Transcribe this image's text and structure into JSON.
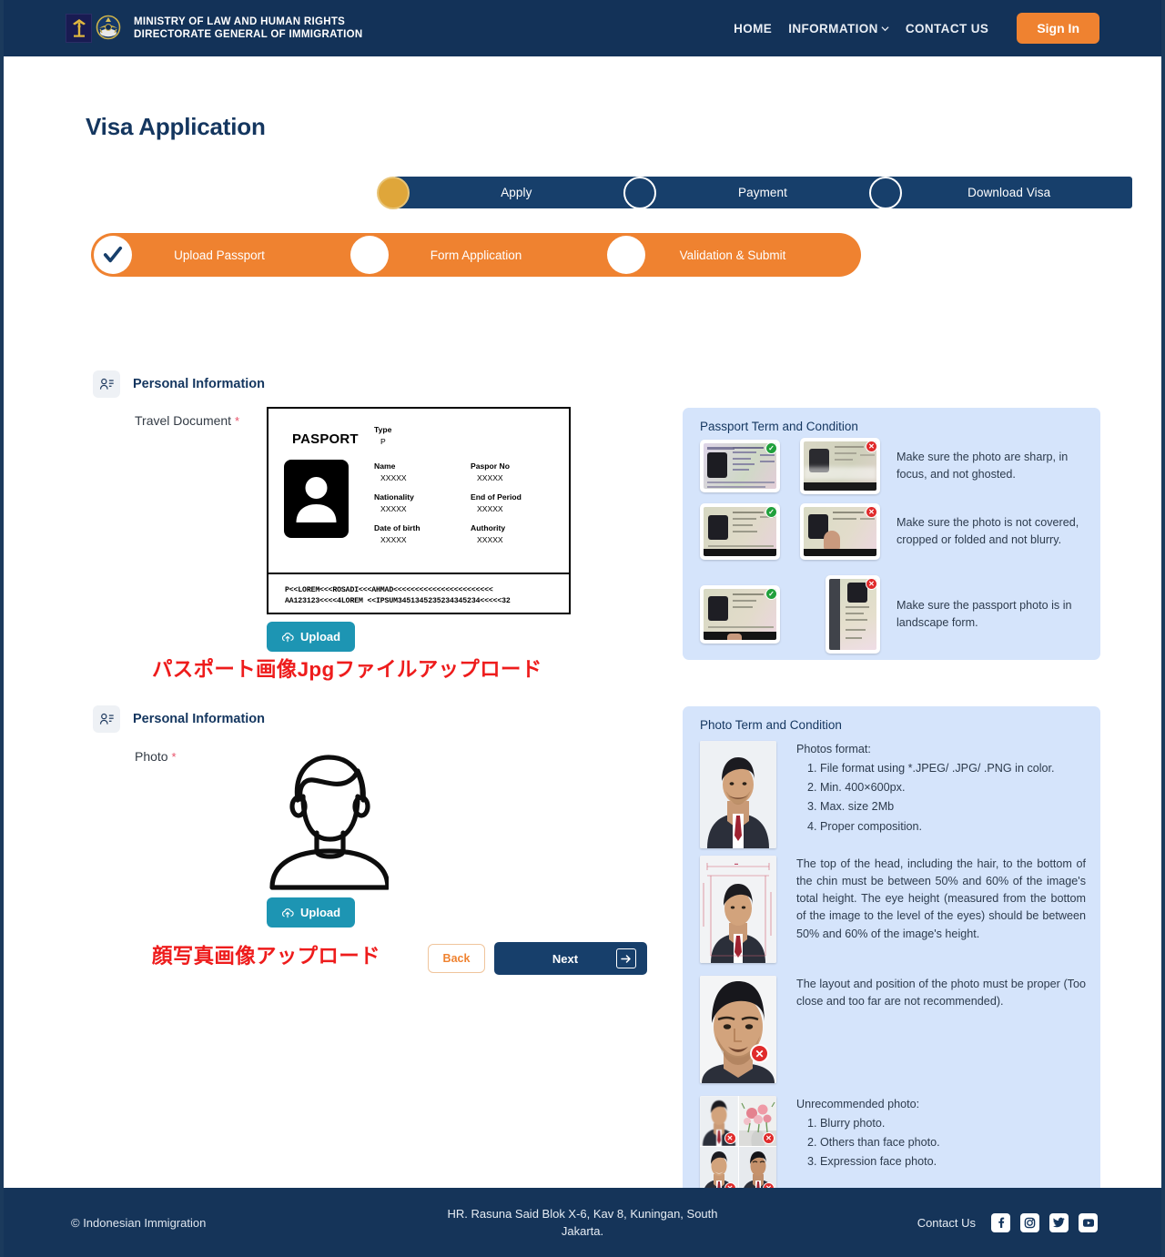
{
  "header": {
    "brand_line1": "MINISTRY OF  LAW  AND HUMAN RIGHTS",
    "brand_line2": "DIRECTORATE GENERAL OF IMMIGRATION",
    "nav": [
      {
        "label": "HOME",
        "has_caret": false
      },
      {
        "label": "INFORMATION",
        "has_caret": true
      },
      {
        "label": "CONTACT US",
        "has_caret": false
      }
    ],
    "sign_in": "Sign In"
  },
  "page": {
    "title": "Visa Application"
  },
  "top_steps": [
    {
      "label": "Apply",
      "state": "active"
    },
    {
      "label": "Payment",
      "state": "pending"
    },
    {
      "label": "Download Visa",
      "state": "pending"
    }
  ],
  "sub_steps": [
    {
      "label": "Upload Passport",
      "state": "done"
    },
    {
      "label": "Form Application",
      "state": "pending"
    },
    {
      "label": "Validation & Submit",
      "state": "pending"
    }
  ],
  "sections": {
    "travel_document": {
      "section_title": "Personal Information",
      "field_label": "Travel Document",
      "required_mark": "*",
      "upload_label": "Upload",
      "annotation": "パスポート画像Jpgファイルアップロード"
    },
    "photo": {
      "section_title": "Personal Information",
      "field_label": "Photo",
      "required_mark": "*",
      "upload_label": "Upload",
      "annotation": "顔写真画像アップロード"
    }
  },
  "passport_preview": {
    "word": "PASPORT",
    "type_key": "Type",
    "type_value": "P",
    "fields": [
      {
        "key": "Name",
        "value": "XXXXX"
      },
      {
        "key": "Paspor No",
        "value": "XXXXX"
      },
      {
        "key": "Nationality",
        "value": "XXXXX"
      },
      {
        "key": "End of Period",
        "value": "XXXXX"
      },
      {
        "key": "Date of birth",
        "value": "XXXXX"
      },
      {
        "key": "Authority",
        "value": "XXXXX"
      }
    ],
    "mrz_line1": "P<<LOREM<<<ROSADI<<<AHMAD<<<<<<<<<<<<<<<<<<<<<<<",
    "mrz_line2": "AA123123<<<<4LOREM <<IPSUM3451345235234345234<<<<<32"
  },
  "buttons": {
    "back": "Back",
    "next": "Next"
  },
  "passport_terms": {
    "title": "Passport Term and Condition",
    "rows": [
      {
        "text": "Make sure the photo are sharp, in focus, and not ghosted.",
        "badges": [
          "ok",
          "no"
        ]
      },
      {
        "text": "Make sure the photo is not covered, cropped or folded and not blurry.",
        "badges": [
          "ok",
          "no"
        ]
      },
      {
        "text": "Make sure the passport photo is in landscape form.",
        "badges": [
          "ok",
          "no"
        ]
      }
    ]
  },
  "photo_terms": {
    "title": "Photo Term and Condition",
    "rules": [
      {
        "heading": "Photos format:",
        "items": [
          "File format using *.JPEG/ .JPG/ .PNG in color.",
          "Min. 400×600px.",
          "Max. size 2Mb",
          "Proper composition."
        ]
      },
      {
        "heading": "The top of the head, including the hair, to the bottom of the chin must be between 50% and 60% of the image's total height. The eye height (measured from the bottom of the image to the level of the eyes) should be between 50% and 60% of the image's height.",
        "items": []
      },
      {
        "heading": "The layout and position of the photo must be proper (Too close and too far are not recommended).",
        "items": []
      },
      {
        "heading": "Unrecommended photo:",
        "items": [
          "Blurry photo.",
          "Others than face photo.",
          "Expression face photo."
        ]
      }
    ]
  },
  "footer": {
    "copyright": "© Indonesian Immigration",
    "address": "HR. Rasuna Said Blok X-6, Kav 8, Kuningan, South Jakarta.",
    "contact_label": "Contact Us",
    "socials": [
      "facebook-icon",
      "instagram-icon",
      "twitter-icon",
      "youtube-icon"
    ]
  },
  "colors": {
    "navy": "#133258",
    "orange": "#ef8230",
    "gold": "#dfa63a",
    "teal": "#1d95b3",
    "panel_blue": "#d5e4fb",
    "annotation_red": "#ee1c1c"
  }
}
